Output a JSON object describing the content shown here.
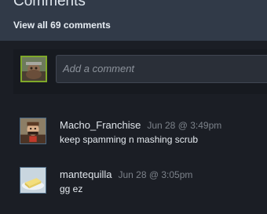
{
  "header": {
    "title": "Comments",
    "view_all_label": "View all 69 comments"
  },
  "compose": {
    "avatar_icon": "user-avatar-icon",
    "placeholder": "Add a comment"
  },
  "comments": [
    {
      "author": "Macho_Franchise",
      "timestamp": "Jun 28 @ 3:49pm",
      "text": "keep spamming n mashing scrub",
      "avatar_icon": "user-avatar-icon"
    },
    {
      "author": "mantequilla",
      "timestamp": "Jun 28 @ 3:05pm",
      "text": "gg ez",
      "avatar_icon": "butter-avatar-icon"
    }
  ],
  "colors": {
    "header_bg": "#313a48",
    "page_bg": "#1b1e25",
    "online_border": "#7fa829",
    "offline_border": "#4d6a84"
  }
}
